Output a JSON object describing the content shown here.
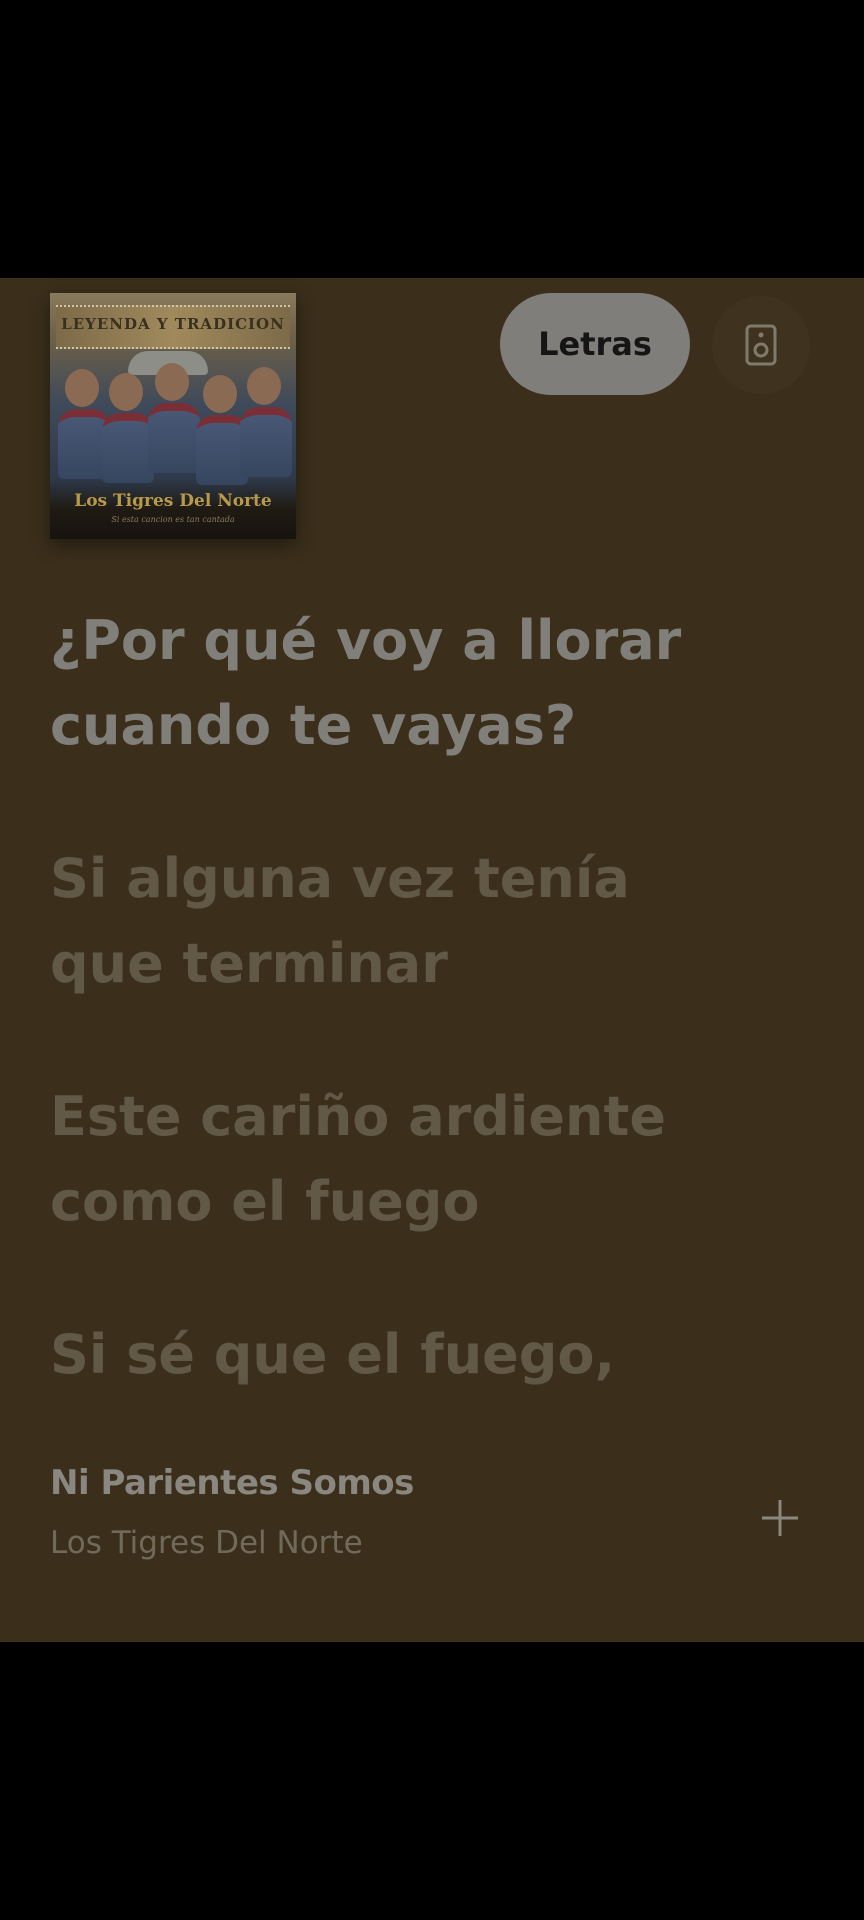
{
  "album": {
    "banner_text": "LEYENDA Y TRADICION",
    "title": "Los Tigres Del Norte",
    "subtitle": "Si esta cancion es tan cantada"
  },
  "header": {
    "lyrics_label": "Letras",
    "speaker_icon": "speaker-icon"
  },
  "lyrics": [
    {
      "lines": [
        "¿Por qué voy a llorar",
        "cuando te vayas?"
      ],
      "state": "active"
    },
    {
      "lines": [
        "Si alguna vez tenía",
        "que terminar"
      ],
      "state": "inactive"
    },
    {
      "lines": [
        "Este cariño ardiente",
        "como el fuego"
      ],
      "state": "inactive"
    },
    {
      "lines": [
        "Si sé que el fuego,",
        ""
      ],
      "state": "inactive"
    }
  ],
  "track": {
    "title": "Ni Parientes Somos",
    "artist": "Los Tigres Del Norte",
    "add_icon": "plus-icon"
  },
  "colors": {
    "panel_bg": "#3b2f1b",
    "active_lyric": "#817f7a",
    "inactive_lyric": "#615845",
    "button_bg": "#807e7a"
  }
}
